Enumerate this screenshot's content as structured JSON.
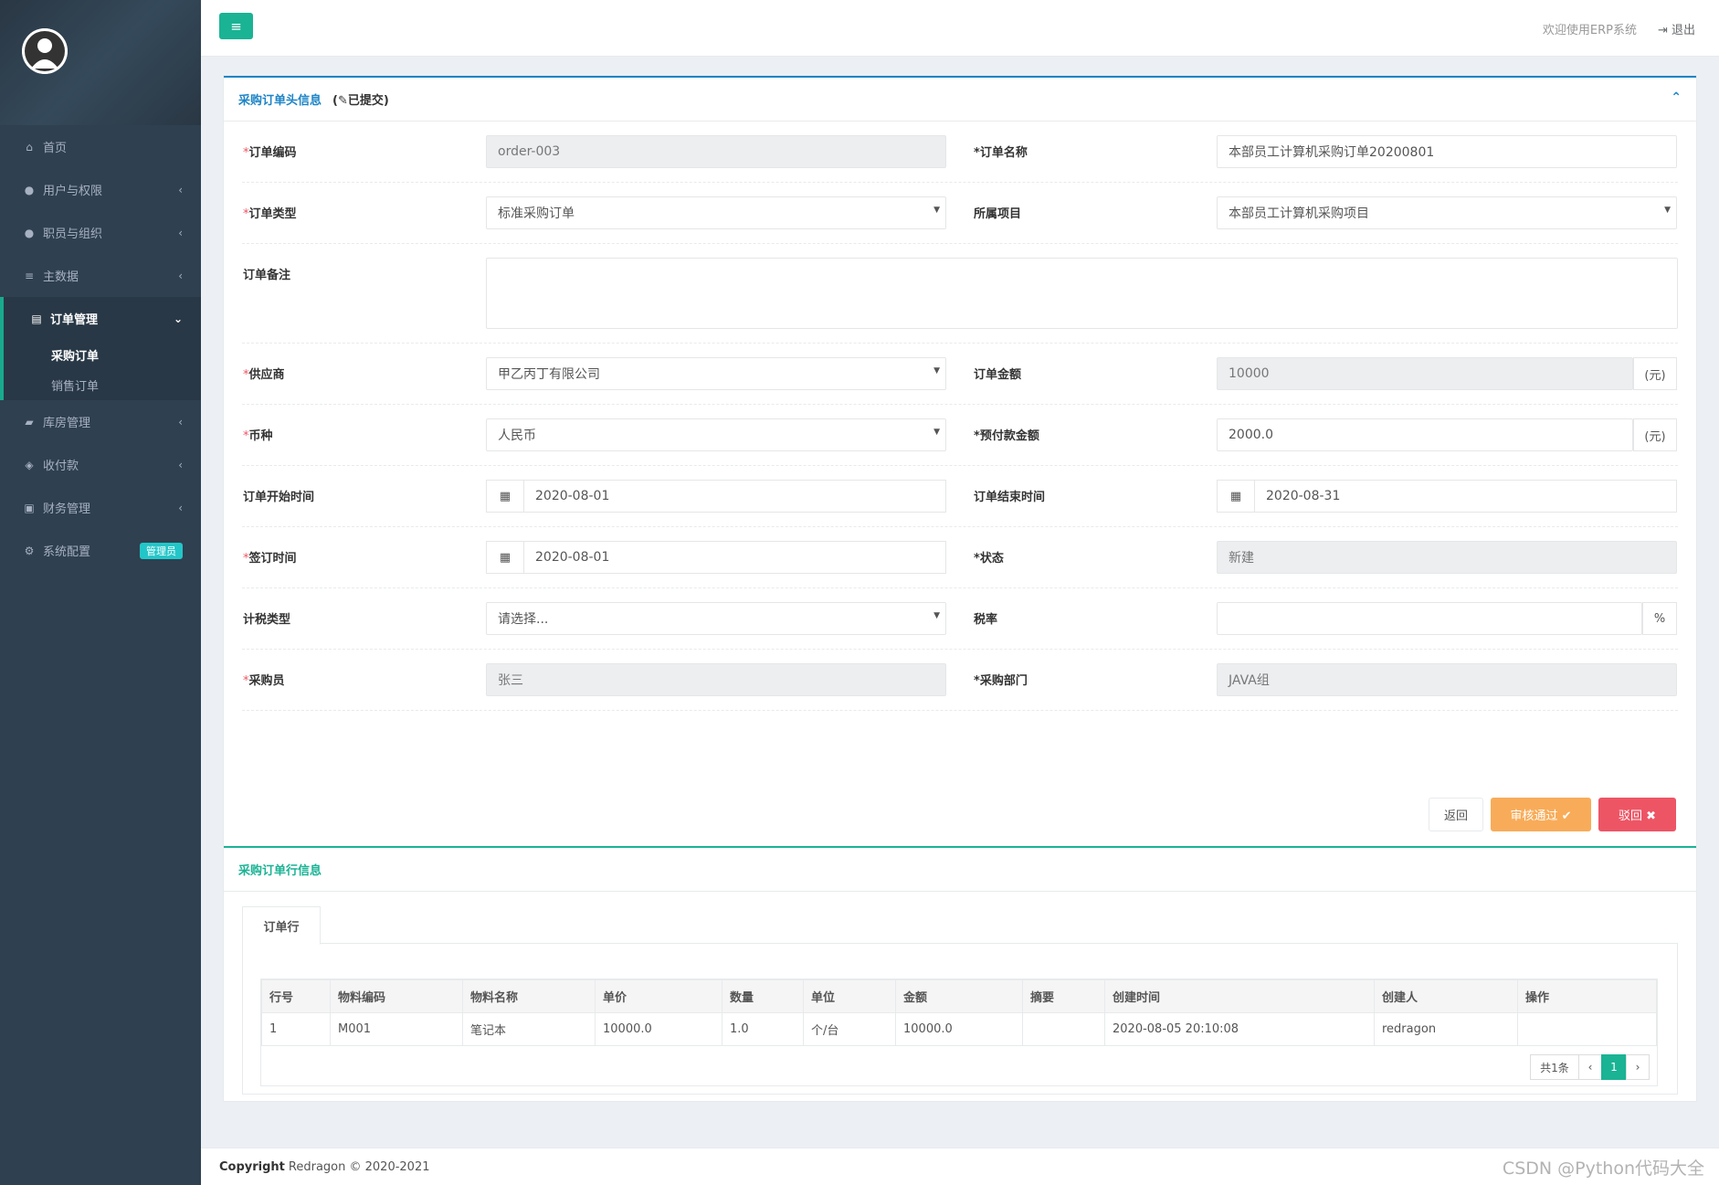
{
  "sidebar": {
    "items": [
      {
        "label": "首页",
        "icon": "home-icon",
        "glyph": "⌂"
      },
      {
        "label": "用户与权限",
        "icon": "lock-icon",
        "glyph": "●"
      },
      {
        "label": "职员与组织",
        "icon": "user-circle-icon",
        "glyph": "●"
      },
      {
        "label": "主数据",
        "icon": "database-icon",
        "glyph": "≡"
      },
      {
        "label": "订单管理",
        "icon": "list-icon",
        "glyph": "▤"
      },
      {
        "label": "库房管理",
        "icon": "truck-icon",
        "glyph": "▰"
      },
      {
        "label": "收付款",
        "icon": "handshake-icon",
        "glyph": "◈"
      },
      {
        "label": "财务管理",
        "icon": "money-icon",
        "glyph": "▣"
      },
      {
        "label": "系统配置",
        "icon": "gear-icon",
        "glyph": "⚙"
      }
    ],
    "sub": [
      "采购订单",
      "销售订单"
    ],
    "admin_badge": "管理员"
  },
  "topbar": {
    "menu_glyph": "≡",
    "welcome": "欢迎使用ERP系统",
    "logout": "⇥ 退出"
  },
  "header": {
    "title": "采购订单头信息",
    "tag": "(✎已提交)"
  },
  "form": {
    "order_code_label": "订单编码",
    "order_code": "order-003",
    "order_name_label": "订单名称",
    "order_name": "本部员工计算机采购订单20200801",
    "order_type_label": "订单类型",
    "order_type": "标准采购订单",
    "project_label": "所属项目",
    "project": "本部员工计算机采购项目",
    "remark_label": "订单备注",
    "supplier_label": "供应商",
    "supplier": "甲乙丙丁有限公司",
    "amount_label": "订单金额",
    "amount": "10000",
    "unit_yuan": "(元)",
    "currency_label": "币种",
    "currency": "人民币",
    "prepay_label": "预付款金额",
    "prepay": "2000.0",
    "start_label": "订单开始时间",
    "start": "2020-08-01",
    "end_label": "订单结束时间",
    "end": "2020-08-31",
    "sign_label": "签订时间",
    "sign": "2020-08-01",
    "status_label": "状态",
    "status": "新建",
    "tax_type_label": "计税类型",
    "tax_type": "请选择...",
    "tax_rate_label": "税率",
    "tax_rate": "",
    "percent": "%",
    "buyer_label": "采购员",
    "buyer": "张三",
    "dept_label": "采购部门",
    "dept": "JAVA组",
    "req": "*"
  },
  "actions": {
    "back": "返回",
    "approve": "审核通过 ✔",
    "reject": "驳回 ✖"
  },
  "lines": {
    "title": "采购订单行信息",
    "tab": "订单行",
    "columns": [
      "行号",
      "物料编码",
      "物料名称",
      "单价",
      "数量",
      "单位",
      "金额",
      "摘要",
      "创建时间",
      "创建人",
      "操作"
    ],
    "rows": [
      [
        "1",
        "M001",
        "笔记本",
        "10000.0",
        "1.0",
        "个/台",
        "10000.0",
        "",
        "2020-08-05 20:10:08",
        "redragon",
        ""
      ]
    ],
    "pager": {
      "info": "共1条",
      "prev": "‹",
      "page": "1",
      "next": "›"
    }
  },
  "footer": {
    "copyright": "Copyright",
    "text": "Redragon © 2020-2021"
  },
  "watermark": "CSDN @Python代码大全"
}
